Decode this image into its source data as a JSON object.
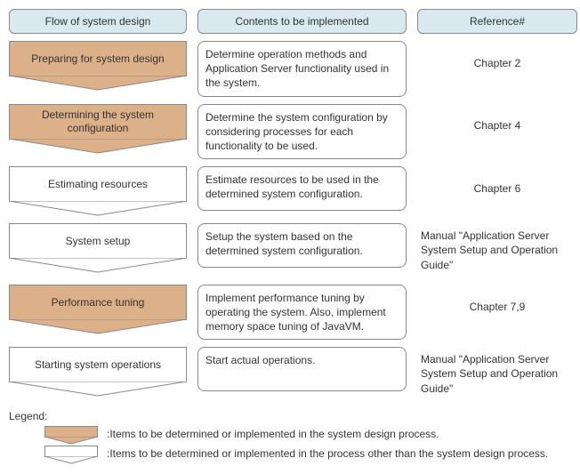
{
  "headers": {
    "flow": "Flow of system design",
    "contents": "Contents to be implemented",
    "reference": "Reference#"
  },
  "rows": [
    {
      "flow": "Preparing for system design",
      "content": "Determine operation methods and Application Server functionality used in the system.",
      "ref": "Chapter 2",
      "filled": true,
      "refCenter": true
    },
    {
      "flow": "Determining the system configuration",
      "content": "Determine the system configuration by considering processes for each functionality to be used.",
      "ref": "Chapter 4",
      "filled": true,
      "refCenter": true
    },
    {
      "flow": "Estimating resources",
      "content": "Estimate resources to be used in the determined system configuration.",
      "ref": "Chapter 6",
      "filled": false,
      "refCenter": true
    },
    {
      "flow": "System setup",
      "content": "Setup the system based on the determined system configuration.",
      "ref": "Manual \"Application Server System Setup and Operation Guide\"",
      "filled": false,
      "refCenter": false
    },
    {
      "flow": "Performance tuning",
      "content": "Implement performance tuning by operating the system. Also, implement memory space tuning of JavaVM.",
      "ref": "Chapter 7,9",
      "filled": true,
      "refCenter": true
    },
    {
      "flow": "Starting system operations",
      "content": "Start actual operations.",
      "ref": "Manual \"Application Server System Setup and Operation Guide\"",
      "filled": false,
      "refCenter": false
    }
  ],
  "legend": {
    "title": "Legend:",
    "filled": ":Items to be determined or implemented in the system design process.",
    "empty": ":Items to be determined or implemented in the process other than the system design process."
  }
}
